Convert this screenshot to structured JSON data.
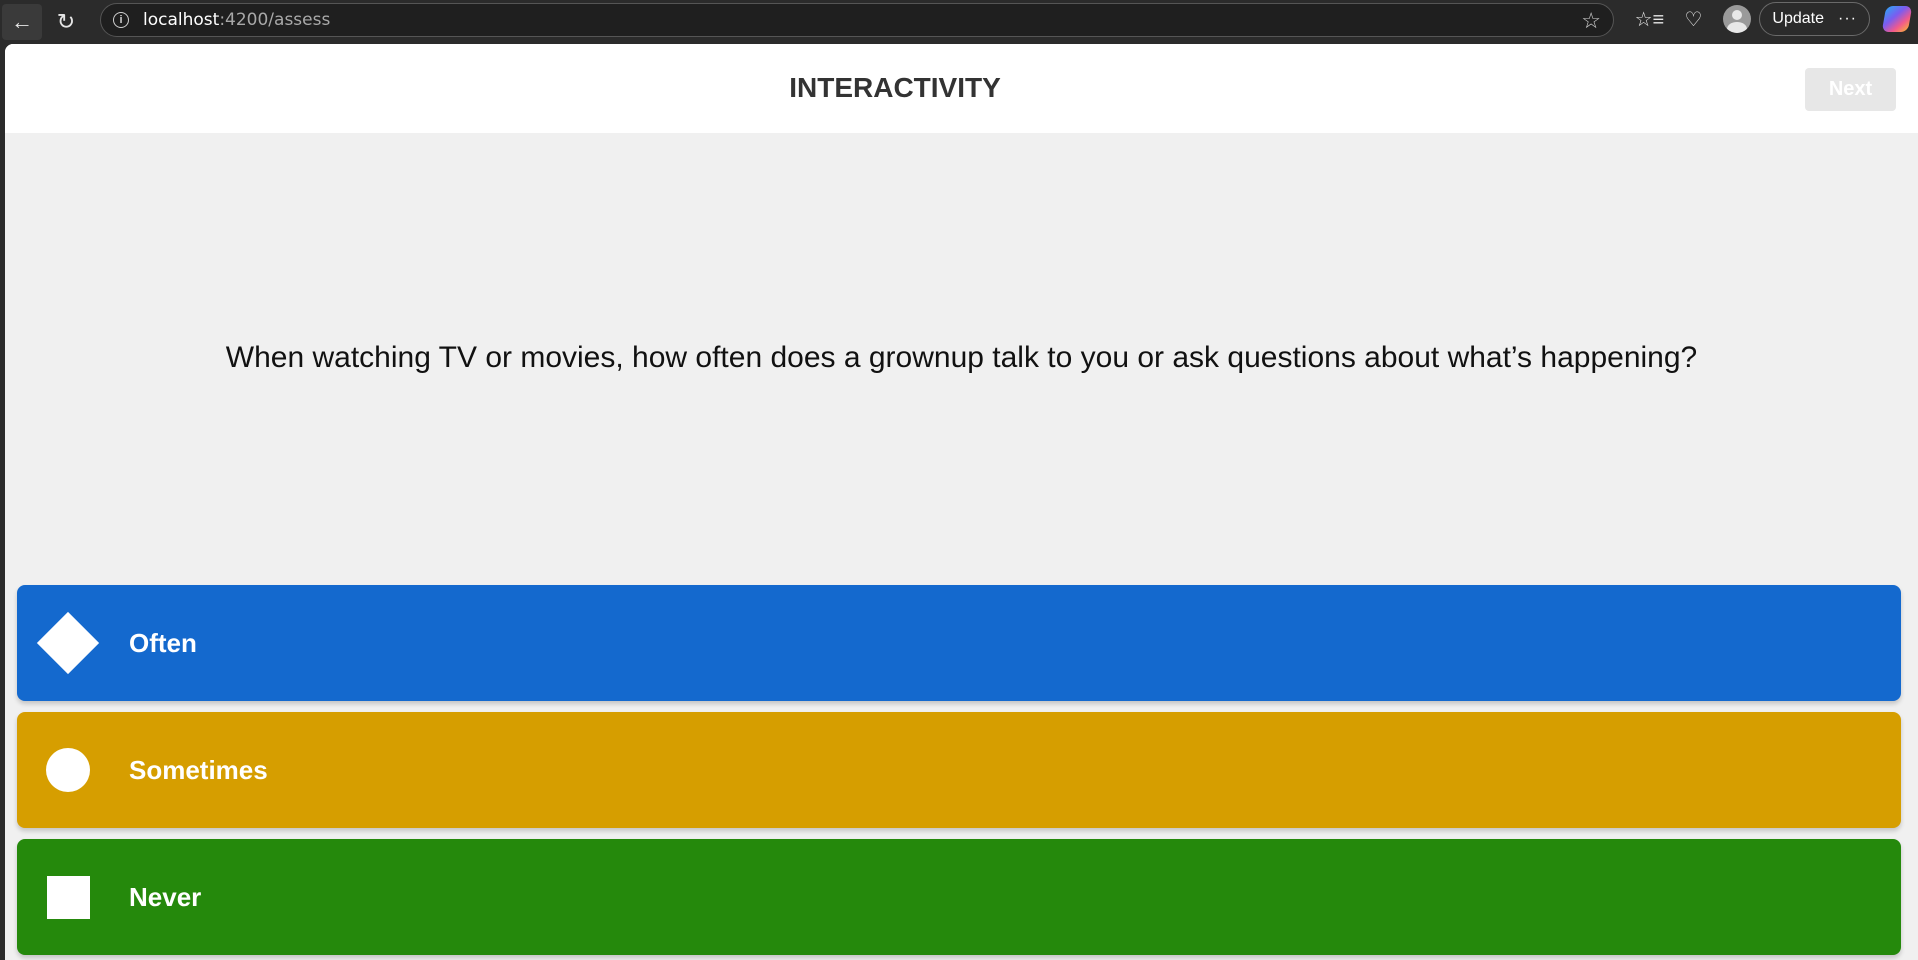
{
  "browser": {
    "url_host": "localhost",
    "url_path": ":4200/assess",
    "update_label": "Update",
    "more_label": "···"
  },
  "header": {
    "title": "INTERACTIVITY",
    "next_label": "Next"
  },
  "question": {
    "text": "When watching TV or movies, how often does a grownup talk to you or ask questions about what’s happening?"
  },
  "answers": [
    {
      "label": "Often",
      "shape": "diamond-icon",
      "color": "#1469CE"
    },
    {
      "label": "Sometimes",
      "shape": "circle-icon",
      "color": "#D69E00"
    },
    {
      "label": "Never",
      "shape": "square-icon",
      "color": "#25890C"
    }
  ]
}
